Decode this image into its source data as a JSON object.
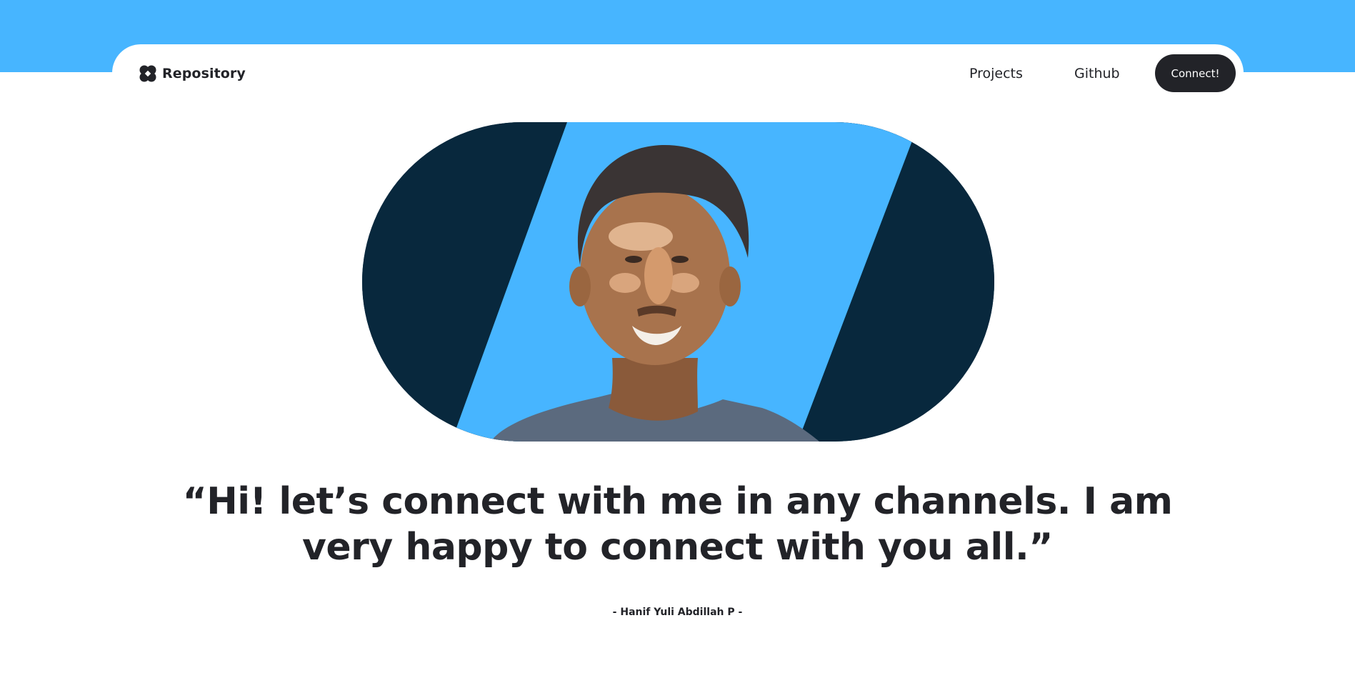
{
  "nav": {
    "brand_name": "Repository",
    "brand_icon": "clover-logo-icon",
    "links": [
      {
        "label": "Projects"
      },
      {
        "label": "Github"
      }
    ],
    "cta_label": "Connect!"
  },
  "hero": {
    "image_alt": "portrait-photo"
  },
  "quote": {
    "text": "“Hi! let’s connect with me in any channels. I am very happy to connect with you all.”",
    "author": "- Hanif Yuli Abdillah P -"
  },
  "colors": {
    "accent_blue": "#47b5ff",
    "dark_navy": "#08283d",
    "text_dark": "#222328",
    "background": "#ffffff"
  }
}
